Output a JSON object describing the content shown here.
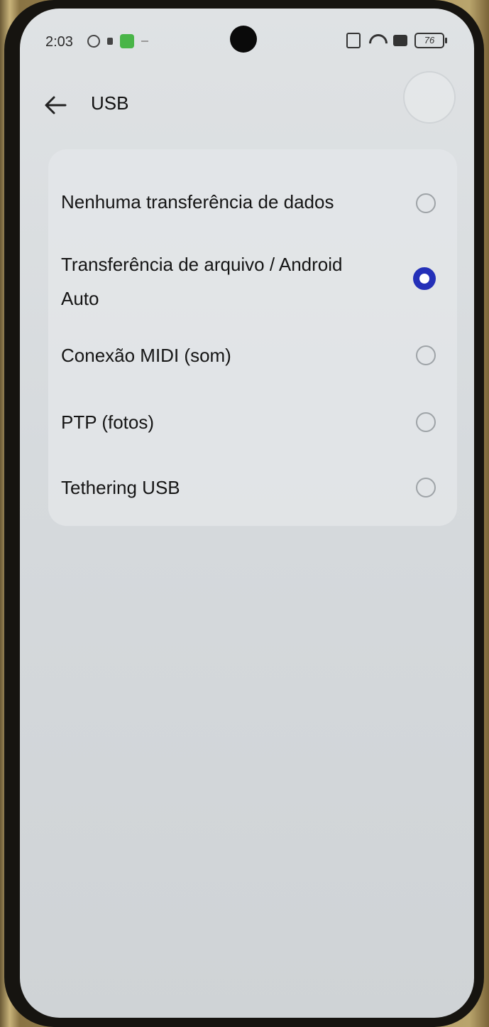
{
  "status_bar": {
    "time": "2:03",
    "battery": "76"
  },
  "app_bar": {
    "title": "USB"
  },
  "options": [
    {
      "label": "Nenhuma transferência de dados",
      "selected": false
    },
    {
      "label": "Transferência de arquivo / Android Auto",
      "selected": true
    },
    {
      "label": "Conexão MIDI (som)",
      "selected": false
    },
    {
      "label": "PTP (fotos)",
      "selected": false
    },
    {
      "label": "Tethering USB",
      "selected": false
    }
  ],
  "colors": {
    "accent": "#2430b8",
    "background": "#d9dcdf",
    "text": "#151515"
  }
}
